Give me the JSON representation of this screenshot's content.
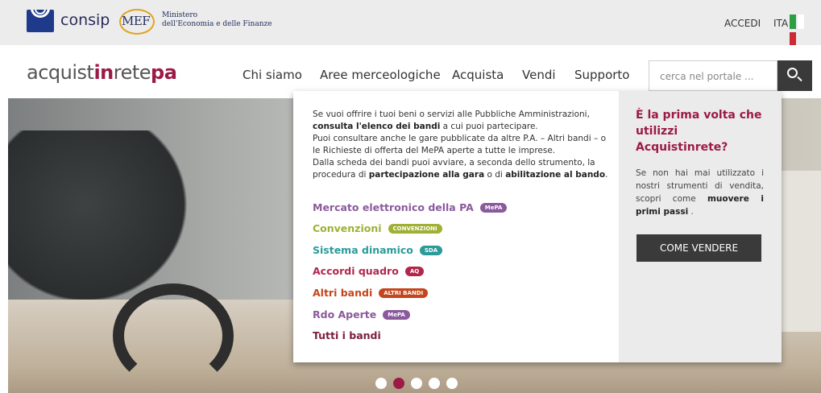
{
  "topbar": {
    "consip_label": "consip",
    "mef_label": "MEF",
    "ministero_line1": "Ministero",
    "ministero_line2": "dell'Economia e delle Finanze",
    "accedi_label": "ACCEDI",
    "lang_label": "ITA",
    "flag_colors": [
      "#2e9e45",
      "#ffffff",
      "#cc2a35"
    ]
  },
  "navbar": {
    "brand_part1": "acquist",
    "brand_part2": "in",
    "brand_part3": "rete",
    "brand_part4": "pa",
    "items": [
      {
        "label": "Chi siamo"
      },
      {
        "label": "Aree merceologiche"
      },
      {
        "label": "Acquista"
      },
      {
        "label": "Vendi"
      },
      {
        "label": "Supporto"
      }
    ],
    "search_placeholder": "cerca nel portale ..."
  },
  "dropdown": {
    "intro": {
      "p1a": "Se vuoi offrire i tuoi beni o servizi alle Pubbliche Amministrazioni,",
      "p1b_bold": "consulta l'elenco dei bandi",
      "p1c": " a cui puoi partecipare.",
      "p2": "Puoi consultare anche le gare pubblicate da altre P.A. – Altri bandi – o le Richieste di offerta del MePA aperte a tutte le imprese.",
      "p3a": "Dalla scheda dei bandi puoi avviare, a seconda dello strumento, la procedura di ",
      "p3b_bold": "partecipazione alla gara",
      "p3c": " o di ",
      "p3d_bold": "abilitazione al bando",
      "p3e": "."
    },
    "links": [
      {
        "label": "Mercato elettronico della PA",
        "badge": "MePA",
        "color": "#8a5a9c",
        "badge_color": "#8a5a9c"
      },
      {
        "label": "Convenzioni",
        "badge": "CONVENZIONI",
        "color": "#9fb034",
        "badge_color": "#9fb034"
      },
      {
        "label": "Sistema dinamico",
        "badge": "SDA",
        "color": "#2b9a9a",
        "badge_color": "#2b9a9a"
      },
      {
        "label": "Accordi quadro",
        "badge": "AQ",
        "color": "#b2264d",
        "badge_color": "#b2264d"
      },
      {
        "label": "Altri bandi",
        "badge": "ALTRI BANDI",
        "color": "#c4461c",
        "badge_color": "#c4461c"
      },
      {
        "label": "Rdo Aperte",
        "badge": "MePA",
        "color": "#8a5a9c",
        "badge_color": "#8a5a9c"
      },
      {
        "label": "Tutti i bandi",
        "badge": "",
        "color": "#7a1f3a",
        "badge_color": ""
      }
    ],
    "side": {
      "title": "È la prima volta che utilizzi Acquistinrete?",
      "text_a": "Se non hai mai utilizzato i nostri strumenti di vendita, scopri come ",
      "text_b_bold": "muovere i primi passi",
      "text_c": " .",
      "button_label": "COME VENDERE"
    }
  },
  "carousel": {
    "slide_count": 5,
    "active_index": 1,
    "active_color": "#9b1b46"
  }
}
